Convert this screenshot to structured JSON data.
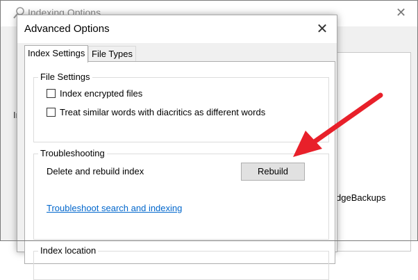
{
  "background_window": {
    "title": "Indexing Options",
    "close_glyph": "✕",
    "left_fragment": "In",
    "list_item_fragment": "dgeBackups"
  },
  "dialog": {
    "title": "Advanced Options",
    "close_glyph": "✕",
    "tabs": [
      {
        "label": "Index Settings",
        "selected": true
      },
      {
        "label": "File Types",
        "selected": false
      }
    ],
    "file_settings": {
      "group_label": "File Settings",
      "checkboxes": [
        {
          "label": "Index encrypted files",
          "checked": false
        },
        {
          "label": "Treat similar words with diacritics as different words",
          "checked": false
        }
      ]
    },
    "troubleshooting": {
      "group_label": "Troubleshooting",
      "rebuild_label": "Delete and rebuild index",
      "rebuild_button": "Rebuild",
      "link": "Troubleshoot search and indexing"
    },
    "index_location": {
      "group_label": "Index location"
    }
  },
  "annotation": {
    "arrow_color": "#e8202a"
  }
}
